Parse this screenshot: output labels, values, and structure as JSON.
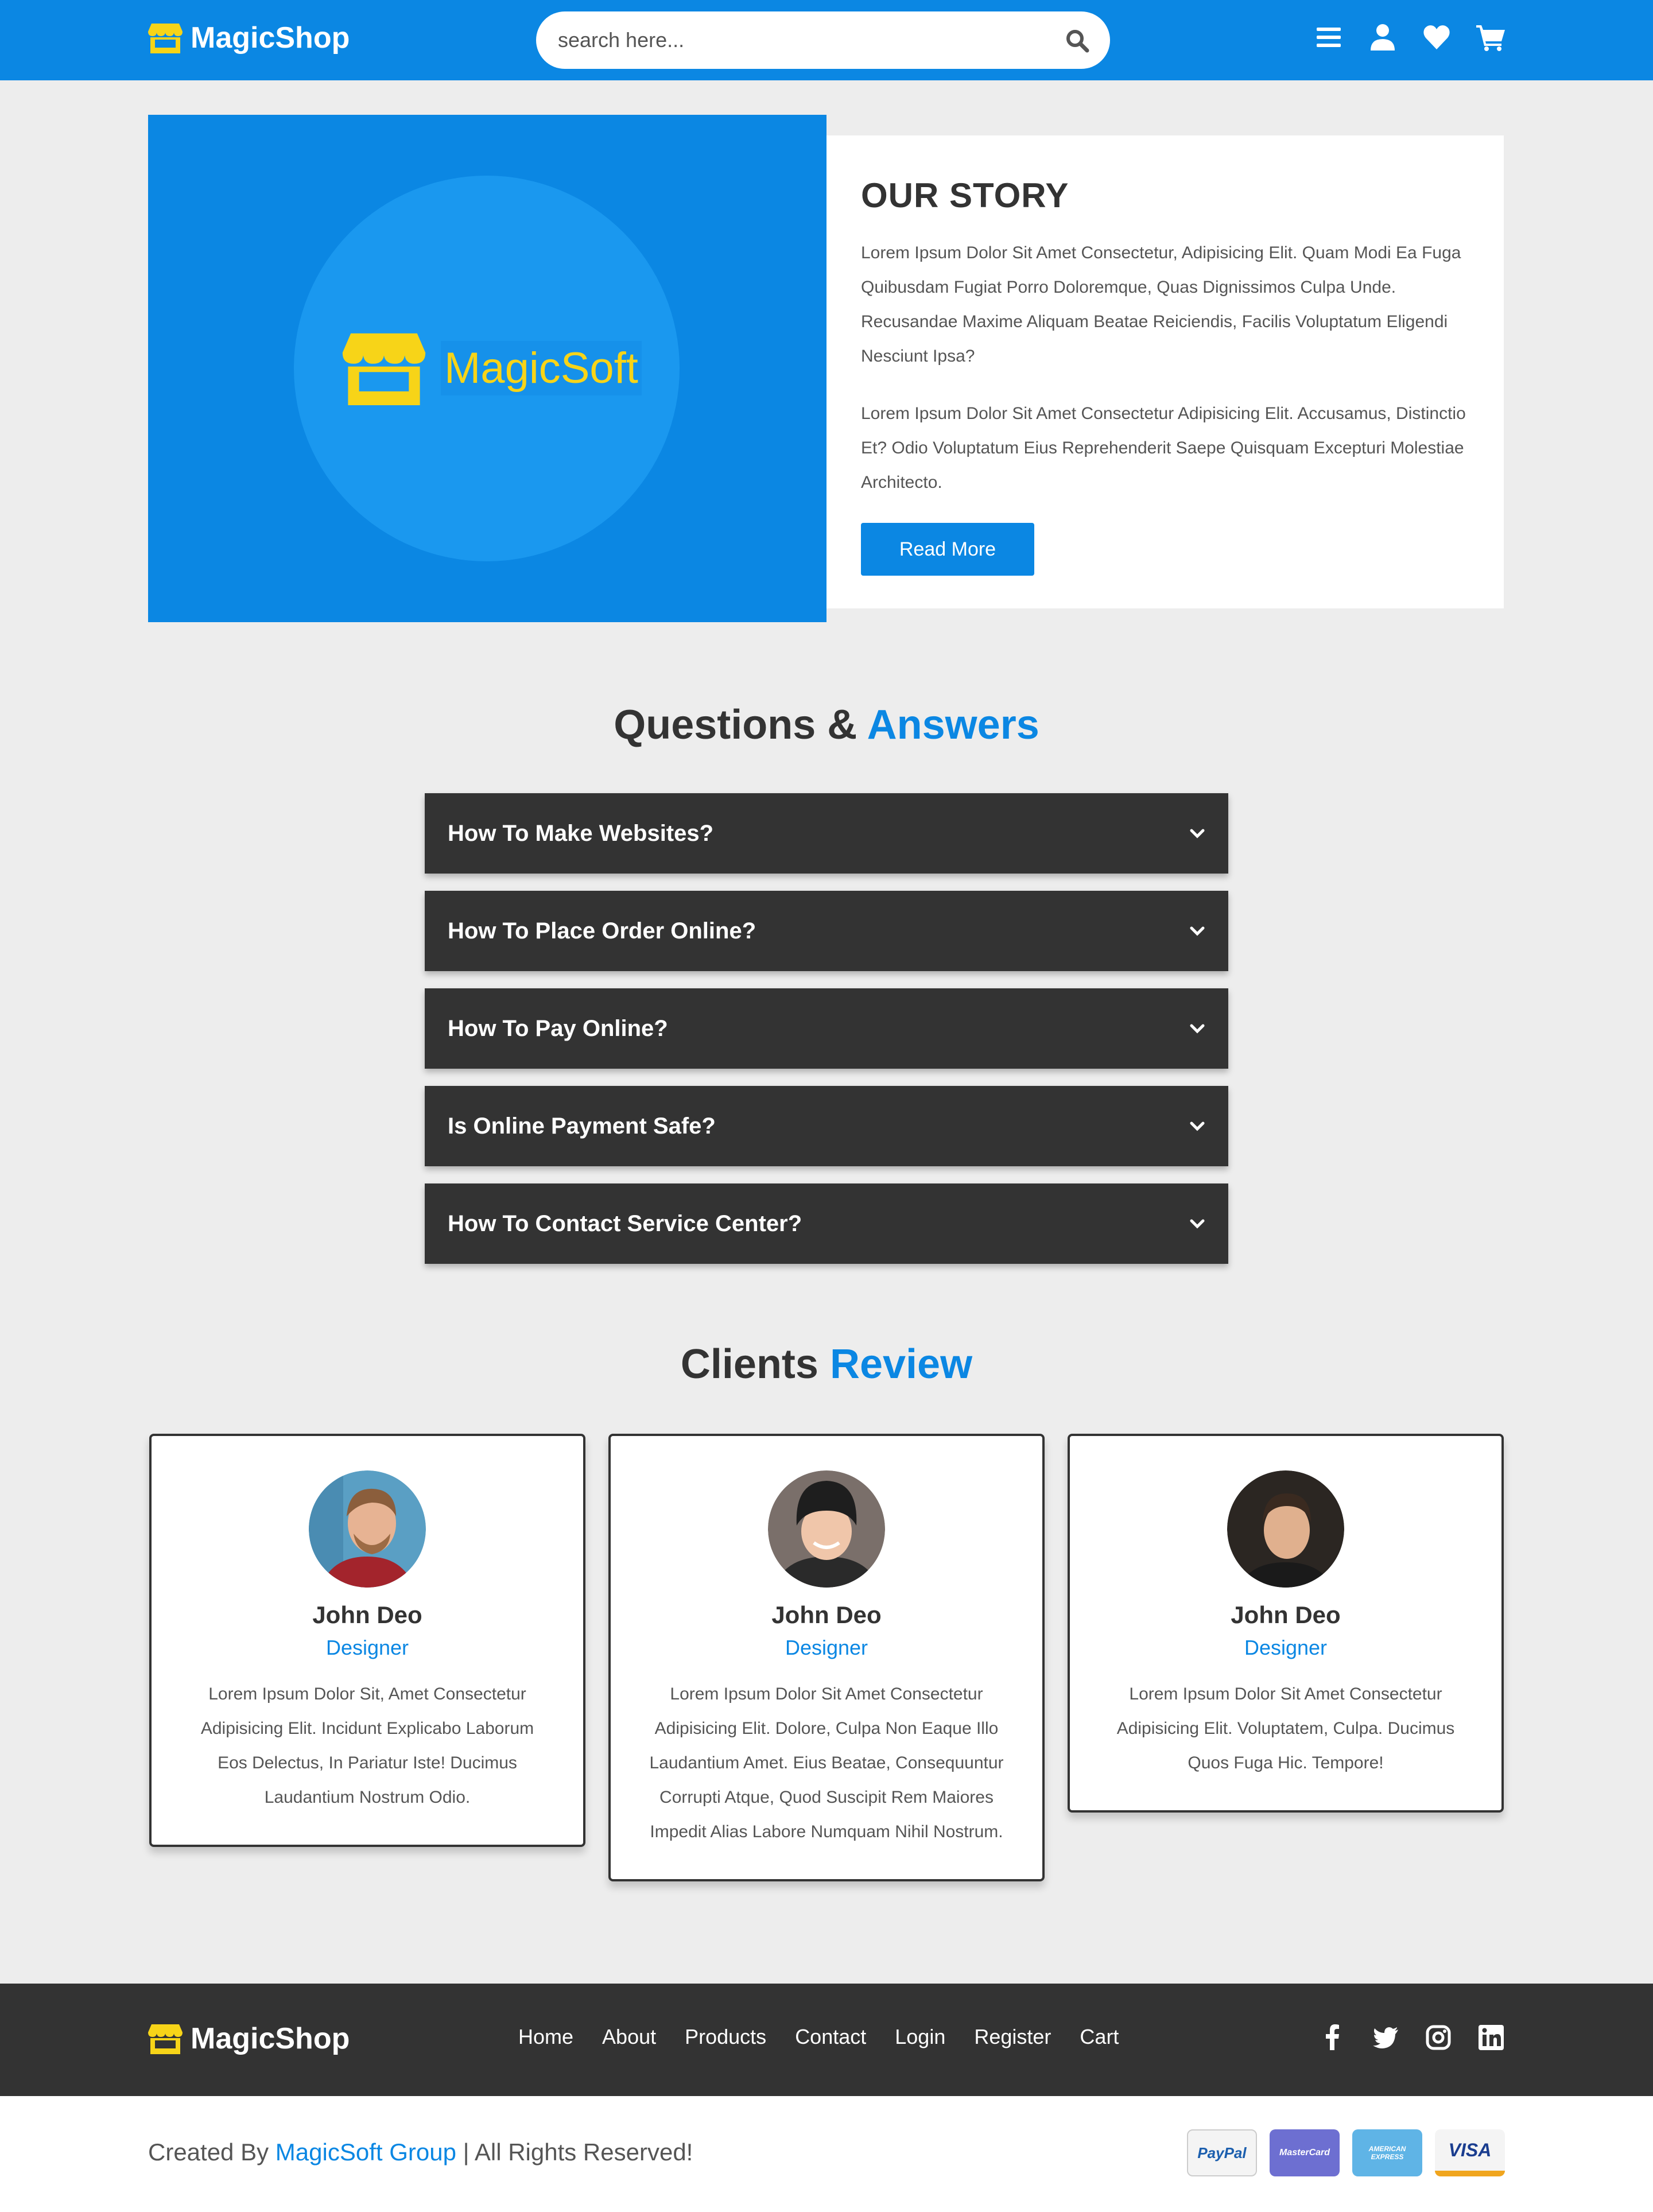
{
  "header": {
    "brand": "MagicShop",
    "search_placeholder": "search here..."
  },
  "story": {
    "logo_text": "MagicSoft",
    "title": "OUR STORY",
    "para1": "Lorem Ipsum Dolor Sit Amet Consectetur, Adipisicing Elit. Quam Modi Ea Fuga Quibusdam Fugiat Porro Doloremque, Quas Dignissimos Culpa Unde. Recusandae Maxime Aliquam Beatae Reiciendis, Facilis Voluptatum Eligendi Nesciunt Ipsa?",
    "para2": "Lorem Ipsum Dolor Sit Amet Consectetur Adipisicing Elit. Accusamus, Distinctio Et? Odio Voluptatum Eius Reprehenderit Saepe Quisquam Excepturi Molestiae Architecto.",
    "button": "Read More"
  },
  "faq": {
    "title_main": "Questions &",
    "title_accent": "Answers",
    "items": [
      {
        "q": "How To Make Websites?"
      },
      {
        "q": "How To Place Order Online?"
      },
      {
        "q": "How To Pay Online?"
      },
      {
        "q": "Is Online Payment Safe?"
      },
      {
        "q": "How To Contact Service Center?"
      }
    ]
  },
  "reviews": {
    "title_main": "Clients",
    "title_accent": "Review",
    "items": [
      {
        "name": "John Deo",
        "role": "Designer",
        "text": "Lorem Ipsum Dolor Sit, Amet Consectetur Adipisicing Elit. Incidunt Explicabo Laborum Eos Delectus, In Pariatur Iste! Ducimus Laudantium Nostrum Odio."
      },
      {
        "name": "John Deo",
        "role": "Designer",
        "text": "Lorem Ipsum Dolor Sit Amet Consectetur Adipisicing Elit. Dolore, Culpa Non Eaque Illo Laudantium Amet. Eius Beatae, Consequuntur Corrupti Atque, Quod Suscipit Rem Maiores Impedit Alias Labore Numquam Nihil Nostrum."
      },
      {
        "name": "John Deo",
        "role": "Designer",
        "text": "Lorem Ipsum Dolor Sit Amet Consectetur Adipisicing Elit. Voluptatem, Culpa. Ducimus Quos Fuga Hic. Tempore!"
      }
    ]
  },
  "footer": {
    "brand": "MagicShop",
    "nav": [
      "Home",
      "About",
      "Products",
      "Contact",
      "Login",
      "Register",
      "Cart"
    ],
    "credit_prefix": "Created By",
    "credit_link": "MagicSoft Group",
    "credit_suffix": "| All Rights Reserved!",
    "payments": [
      {
        "label": "PayPal",
        "bg": "#f4f4f4",
        "color": "#1c5fae"
      },
      {
        "label": "MasterCard",
        "bg": "#6d6fd1",
        "color": "#ffffff"
      },
      {
        "label": "AMERICAN EXPRESS",
        "bg": "#5fb4e6",
        "color": "#ffffff"
      },
      {
        "label": "VISA",
        "bg": "#f4f4f4",
        "color": "#1a3d8f"
      }
    ]
  },
  "colors": {
    "accent": "#0b87e3",
    "dark": "#333333",
    "logo_yellow": "#f7d418"
  }
}
